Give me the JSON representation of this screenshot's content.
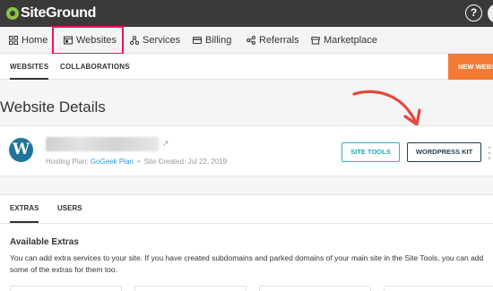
{
  "topbar": {
    "brand": "SiteGround",
    "help_symbol": "?"
  },
  "main_nav": [
    {
      "label": "Home",
      "icon": "grid-icon"
    },
    {
      "label": "Websites",
      "icon": "browser-window-icon",
      "active": true
    },
    {
      "label": "Services",
      "icon": "nodes-icon"
    },
    {
      "label": "Billing",
      "icon": "credit-card-icon"
    },
    {
      "label": "Referrals",
      "icon": "share-icon"
    },
    {
      "label": "Marketplace",
      "icon": "store-icon"
    }
  ],
  "sub_nav": {
    "tabs": [
      "WEBSITES",
      "COLLABORATIONS"
    ],
    "new_site_label": "NEW WEBSITE"
  },
  "page": {
    "title": "Website Details"
  },
  "site": {
    "external_link_symbol": "↗",
    "hosting_plan_label": "Hosting Plan:",
    "hosting_plan": "GoGeek Plan",
    "separator": "•",
    "created": "Site Created: Jul 22, 2019",
    "site_tools_label": "SITE TOOLS",
    "wordpress_kit_label": "WORDPRESS KIT",
    "wp_letter": "W"
  },
  "detail_tabs": [
    "EXTRAS",
    "USERS"
  ],
  "extras": {
    "title": "Available Extras",
    "description": "You can add extra services to your site. If you have created subdomains and parked domains of your main site in the Site Tools, you can add some of the extras for them too."
  },
  "colors": {
    "topbar": "#3a3a3a",
    "highlight": "#e5175a",
    "accent_orange": "#f47b35",
    "plan_link": "#2b9bd6",
    "site_tools_border": "#2fb3c6",
    "wp_kit_border": "#1f3f4f",
    "annotation_arrow": "#e5483a"
  }
}
